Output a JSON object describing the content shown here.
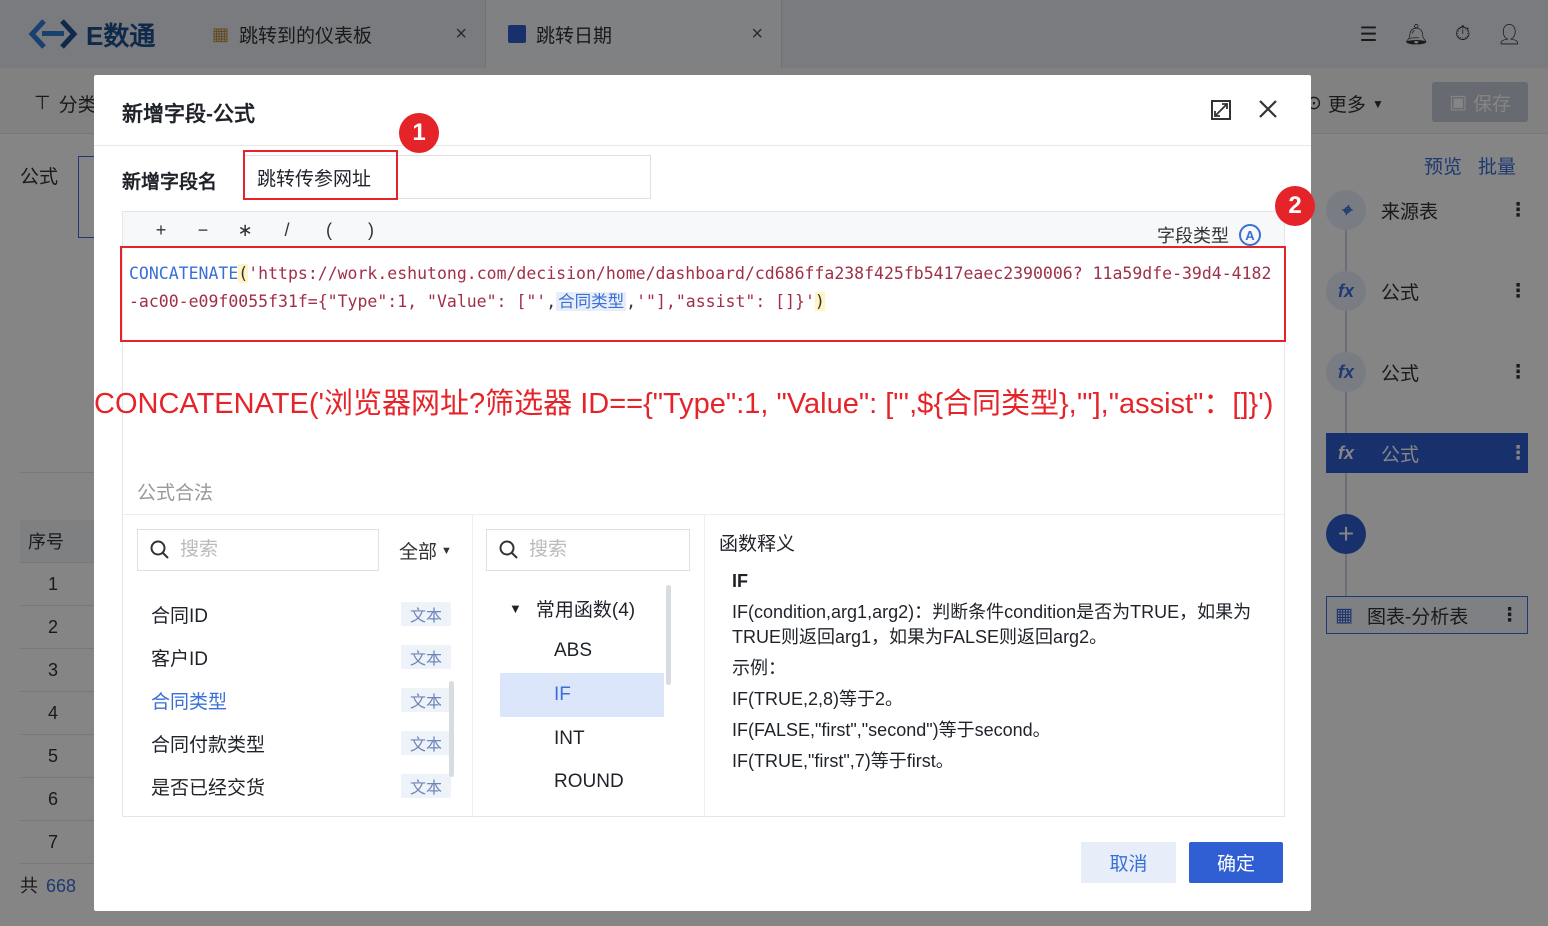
{
  "app": {
    "logo_text": "E数通",
    "tabs": [
      {
        "label": "跳转到的仪表板",
        "close": "×"
      },
      {
        "label": "跳转日期",
        "close": "×"
      }
    ]
  },
  "toolbar": {
    "left_label": "分类",
    "more_label": "更多",
    "save_label": "保存"
  },
  "left_panel": {
    "formula_label": "公式",
    "table_header": "序号",
    "rows": [
      "1",
      "2",
      "3",
      "4",
      "5",
      "6",
      "7"
    ],
    "total_prefix": "共",
    "total_count": "668"
  },
  "right_panel": {
    "preview_link": "预览",
    "batch_link": "批量",
    "nodes": [
      "来源表",
      "公式",
      "公式",
      "公式"
    ],
    "chart_node": "图表-分析表",
    "add_symbol": "+",
    "node_menu": "⋮"
  },
  "dialog": {
    "title": "新增字段-公式",
    "field_name_label": "新增字段名",
    "field_name_value": "跳转传参网址",
    "operators": [
      "+",
      "−",
      "∗",
      "/",
      "(",
      ")"
    ],
    "field_type_label": "字段类型",
    "formula": {
      "fn": "CONCATENATE",
      "open": "(",
      "str1": "'https://work.eshutong.com/decision/home/dashboard/cd686ffa238f425fb5417eaec2390006? 11a59dfe-39d4-4182-ac00-e09f0055f31f={\"Type\":1, \"Value\": [\"'",
      "comma1": ",",
      "field": "合同类型",
      "comma2": ",",
      "str2": "'\"],\"assist\": []}'",
      "close": ")"
    },
    "hint": "公式合法",
    "field_search_placeholder": "搜索",
    "filter_label": "全部",
    "fields": [
      {
        "name": "合同ID",
        "type": "文本"
      },
      {
        "name": "客户ID",
        "type": "文本"
      },
      {
        "name": "合同类型",
        "type": "文本"
      },
      {
        "name": "合同付款类型",
        "type": "文本"
      },
      {
        "name": "是否已经交货",
        "type": "文本"
      }
    ],
    "fn_search_placeholder": "搜索",
    "fn_group": "常用函数(4)",
    "functions": [
      "ABS",
      "IF",
      "INT",
      "ROUND"
    ],
    "doc_title": "函数释义",
    "doc": {
      "name": "IF",
      "desc": "IF(condition,arg1,arg2)：判断条件condition是否为TRUE，如果为TRUE则返回arg1，如果为FALSE则返回arg2。",
      "example_label": "示例：",
      "examples": [
        "IF(TRUE,2,8)等于2。",
        "IF(FALSE,\"first\",\"second\")等于second。",
        "IF(TRUE,\"first\",7)等于first。"
      ]
    },
    "cancel_label": "取消",
    "ok_label": "确定"
  },
  "annotations": {
    "badge1": "1",
    "badge2": "2",
    "note": "CONCATENATE('浏览器网址?筛选器 ID=={\"Type\":1, \"Value\": [\"',${合同类型},'\"],\"assist\"：[]}')",
    "color": "#e5242a"
  },
  "colors": {
    "primary": "#2f5fd2",
    "link": "#3a6fd8",
    "annotation": "#e5242a"
  }
}
